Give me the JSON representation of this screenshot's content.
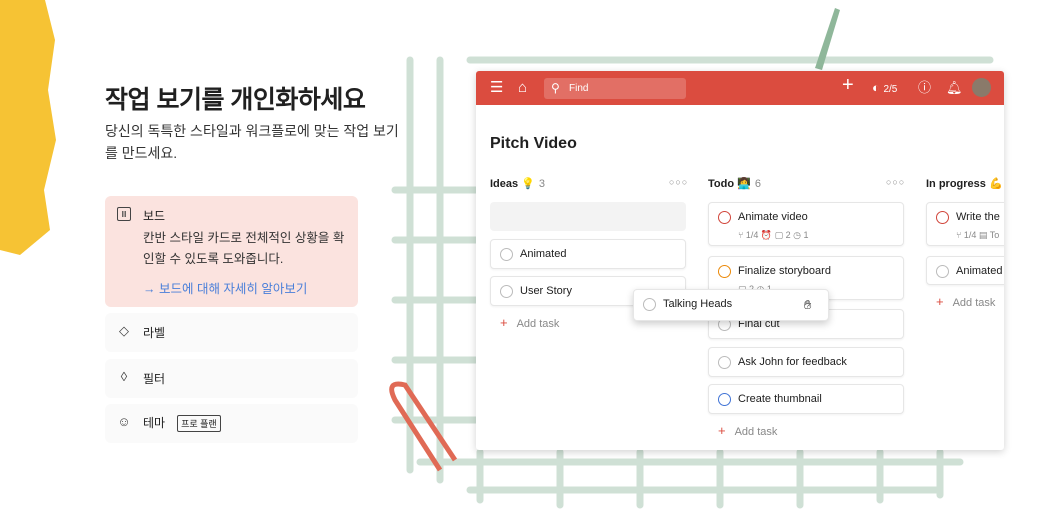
{
  "hero": {
    "title": "작업 보기를 개인화하세요",
    "subtitle": "당신의 독특한 스타일과 워크플로에 맞는 작업 보기를 만드세요."
  },
  "features": [
    {
      "icon": "board-icon",
      "label": "보드",
      "description": "칸반 스타일 카드로 전체적인 상황을 확인할 수 있도록 도와줍니다.",
      "link": "→ 보드에 대해 자세히 알아보기",
      "active": true
    },
    {
      "icon": "tag-icon",
      "label": "라벨"
    },
    {
      "icon": "drop-icon",
      "label": "필터"
    },
    {
      "icon": "palette-icon",
      "label": "테마",
      "badge": "프로 플랜"
    }
  ],
  "app": {
    "accent": "#db4c3f",
    "search_placeholder": "Find",
    "karma": "2/5",
    "project_title": "Pitch Video",
    "columns": [
      {
        "name": "Ideas 💡",
        "count": "3",
        "tasks": [
          {
            "title": "Animated"
          },
          {
            "title": "User Story"
          }
        ],
        "add": "Add task"
      },
      {
        "name": "Todo 👩‍💻",
        "count": "6",
        "tasks": [
          {
            "title": "Animate video",
            "meta": "⑂ 1/4   ⏰   ▢ 2   ◷ 1",
            "color": "#d1453b"
          },
          {
            "title": "Finalize storyboard",
            "meta": "▢ 2   ◷ 1",
            "color": "#eb8909"
          },
          {
            "title": "Final cut"
          },
          {
            "title": "Ask John for feedback"
          },
          {
            "title": "Create thumbnail",
            "color": "#4073d6"
          }
        ],
        "add": "Add task"
      },
      {
        "name": "In progress 💪",
        "tasks": [
          {
            "title": "Write the",
            "meta": "⑂ 1/4  ▤ To",
            "color": "#d1453b"
          },
          {
            "title": "Animated"
          }
        ],
        "add": "Add task"
      }
    ],
    "dragging": "Talking Heads"
  }
}
